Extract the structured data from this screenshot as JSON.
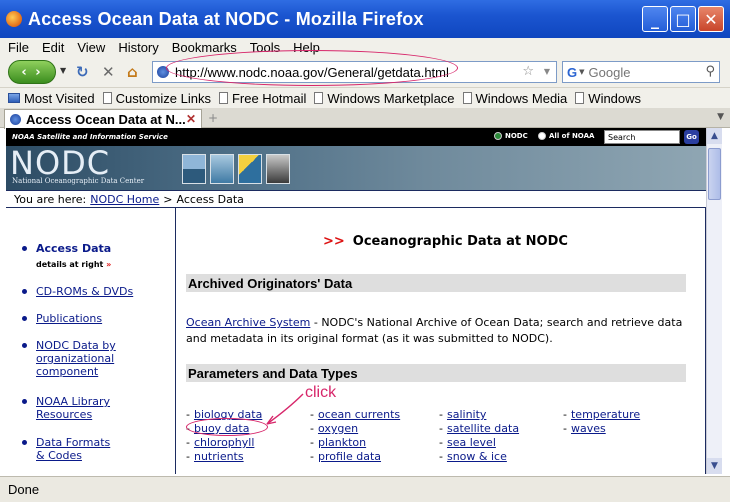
{
  "window": {
    "title": "Access Ocean Data at NODC - Mozilla Firefox",
    "controls": {
      "minimize": "_",
      "maximize": "□",
      "close": "✕"
    }
  },
  "menu": [
    "File",
    "Edit",
    "View",
    "History",
    "Bookmarks",
    "Tools",
    "Help"
  ],
  "navbar": {
    "url": "http://www.nodc.noaa.gov/General/getdata.html",
    "search_placeholder": "Google"
  },
  "bookmarks": [
    "Most Visited",
    "Customize Links",
    "Free Hotmail",
    "Windows Marketplace",
    "Windows Media",
    "Windows"
  ],
  "tab": {
    "label": "Access Ocean Data at N...",
    "new_tab": "+"
  },
  "status": "Done",
  "page": {
    "noaa_service": "NOAA Satellite and Information Service",
    "scope_nodc": "NODC",
    "scope_all": "All of NOAA",
    "search_value": "Search",
    "go_label": "Go",
    "banner_title": "NODC",
    "banner_subtitle": "National Oceanographic Data Center",
    "breadcrumb": {
      "prefix": "You are here:",
      "home": "NODC Home",
      "sep": ">",
      "current": "Access Data"
    },
    "sidebar": [
      {
        "label": "Access Data",
        "active": true,
        "detail": "details at right",
        "detail_mark": "»"
      },
      {
        "label": "CD-ROMs & DVDs"
      },
      {
        "label": "Publications"
      },
      {
        "label": "NODC Data by organizational component"
      },
      {
        "label": "NOAA Library Resources"
      },
      {
        "label": "Data Formats & Codes"
      }
    ],
    "main_title_mark": ">>",
    "main_title": "Oceanographic Data at NODC",
    "archived_heading": "Archived Originators' Data",
    "archive_link": "Ocean Archive System",
    "archive_text": " - NODC's National Archive of Ocean Data; search and retrieve data and metadata in its original format (as it was submitted to NODC).",
    "params_heading": "Parameters and Data Types",
    "params": [
      [
        "biology data",
        "buoy data",
        "chlorophyll",
        "nutrients"
      ],
      [
        "ocean currents",
        "oxygen",
        "plankton",
        "profile data"
      ],
      [
        "salinity",
        "satellite data",
        "sea level",
        "snow & ice"
      ],
      [
        "temperature",
        "waves"
      ]
    ],
    "annotation": "click"
  }
}
